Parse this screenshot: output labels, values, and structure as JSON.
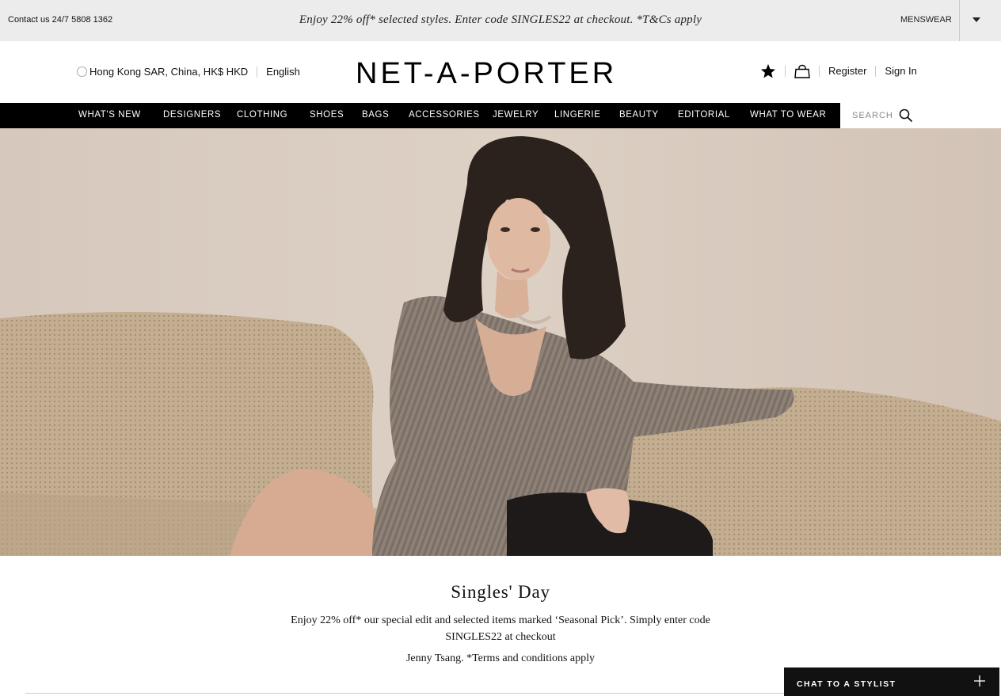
{
  "topbar": {
    "contact": "Contact us 24/7 5808 1362",
    "promo": "Enjoy 22% off* selected styles. Enter code SINGLES22 at checkout. *T&Cs apply",
    "menswear": "MENSWEAR"
  },
  "header": {
    "region": "Hong Kong SAR, China, HK$ HKD",
    "language": "English",
    "logo": "NET-A-PORTER",
    "register": "Register",
    "sign_in": "Sign In"
  },
  "nav": {
    "items": [
      "WHAT'S NEW",
      "DESIGNERS",
      "CLOTHING",
      "SHOES",
      "BAGS",
      "ACCESSORIES",
      "JEWELRY",
      "LINGERIE",
      "BEAUTY",
      "EDITORIAL",
      "WHAT TO WEAR"
    ],
    "search_placeholder": "SEARCH"
  },
  "hero": {
    "title": "Singles' Day",
    "text": "Enjoy 22% off* our special edit and selected items marked ‘Seasonal Pick’. Simply enter code SINGLES22 at checkout",
    "credit": "Jenny Tsang. *Terms and conditions apply"
  },
  "chat": {
    "label": "CHAT TO A STYLIST"
  },
  "colors": {
    "topbar_bg": "#ececec",
    "nav_bg": "#000000",
    "chat_bg": "#111111"
  }
}
